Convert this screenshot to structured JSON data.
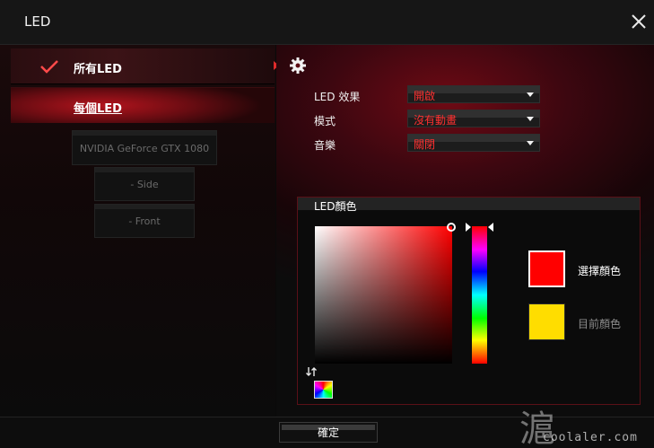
{
  "window": {
    "title": "LED",
    "close_icon": "close-icon"
  },
  "nav": {
    "all_led": "所有LED",
    "each_led": "每個LED",
    "devices": [
      "NVIDIA GeForce GTX 1080",
      "- Side",
      "- Front"
    ]
  },
  "settings": {
    "effect_label": "LED 效果",
    "effect_value": "開啟",
    "mode_label": "模式",
    "mode_value": "沒有動畫",
    "music_label": "音樂",
    "music_value": "關閉"
  },
  "led_color": {
    "title": "LED顏色",
    "selected_label": "選擇顏色",
    "current_label": "目前顏色",
    "selected_color": "#ff0000",
    "current_color": "#ffdd00"
  },
  "footer": {
    "ok": "確定"
  },
  "watermark": {
    "glyph": "滬",
    "site": "coolaler.com"
  },
  "colors": {
    "accent": "#e02b2b",
    "dropdown_text": "#ff3030"
  }
}
